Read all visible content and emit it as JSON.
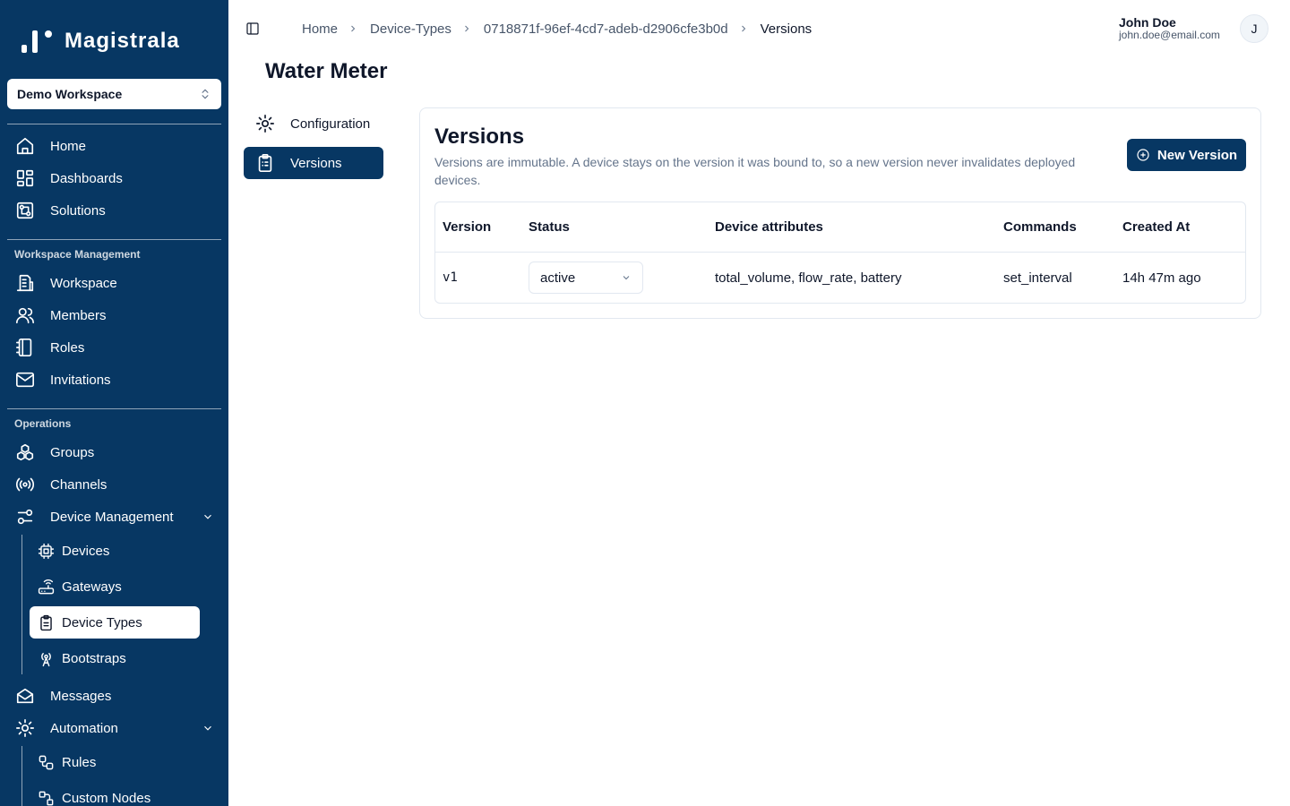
{
  "brand": {
    "name": "Magistrala"
  },
  "workspace_selector": {
    "value": "Demo Workspace",
    "icon": "chevrons-up-down-icon"
  },
  "sidebar": {
    "top_items": [
      {
        "label": "Home",
        "icon": "home-icon"
      },
      {
        "label": "Dashboards",
        "icon": "dashboard-icon"
      },
      {
        "label": "Solutions",
        "icon": "solutions-icon"
      }
    ],
    "workspace_management": {
      "label": "Workspace Management",
      "items": [
        {
          "label": "Workspace",
          "icon": "building-icon"
        },
        {
          "label": "Members",
          "icon": "users-icon"
        },
        {
          "label": "Roles",
          "icon": "notebook-icon"
        },
        {
          "label": "Invitations",
          "icon": "mail-icon"
        }
      ]
    },
    "operations": {
      "label": "Operations",
      "items": [
        {
          "label": "Groups",
          "icon": "boxes-icon"
        },
        {
          "label": "Channels",
          "icon": "radio-icon"
        },
        {
          "label": "Device Management",
          "icon": "sliders-icon",
          "expanded": true
        }
      ],
      "device_management_children": [
        {
          "label": "Devices",
          "icon": "cpu-icon"
        },
        {
          "label": "Gateways",
          "icon": "router-icon"
        },
        {
          "label": "Device Types",
          "icon": "clipboard-icon",
          "active": true
        },
        {
          "label": "Bootstraps",
          "icon": "antenna-icon"
        }
      ],
      "more_items": [
        {
          "label": "Messages",
          "icon": "mail-open-icon"
        },
        {
          "label": "Automation",
          "icon": "gear-icon",
          "expanded": true
        }
      ],
      "automation_children": [
        {
          "label": "Rules",
          "icon": "workflow-icon"
        },
        {
          "label": "Custom Nodes",
          "icon": "nodes-icon"
        }
      ]
    }
  },
  "header": {
    "breadcrumb": [
      "Home",
      "Device-Types",
      "0718871f-96ef-4cd7-adeb-d2906cfe3b0d",
      "Versions"
    ],
    "user": {
      "name": "John Doe",
      "email": "john.doe@email.com",
      "initial": "J"
    }
  },
  "page": {
    "title": "Water Meter",
    "tabs": [
      {
        "label": "Configuration",
        "icon": "gear-icon"
      },
      {
        "label": "Versions",
        "icon": "clipboard-list-icon",
        "active": true
      }
    ]
  },
  "versions_card": {
    "title": "Versions",
    "description": "Versions are immutable. A device stays on the version it was bound to, so a new version never invalidates deployed devices.",
    "new_button_label": "New Version",
    "columns": [
      "Version",
      "Status",
      "Device attributes",
      "Commands",
      "Created At"
    ],
    "rows": [
      {
        "version": "v1",
        "status": "active",
        "device_attributes": "total_volume, flow_rate, battery",
        "commands": "set_interval",
        "created_at": "14h 47m ago"
      }
    ]
  },
  "colors": {
    "sidebar": "#073763",
    "primary_button": "#073763",
    "text": "#0f172a",
    "muted": "#64748b"
  }
}
